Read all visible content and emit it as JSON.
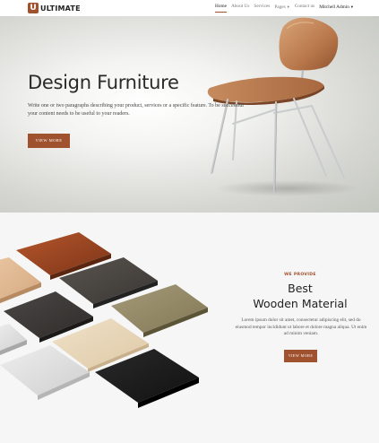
{
  "brand": {
    "logo_letter": "U",
    "name": "ULTIMATE",
    "accent": "#a0512d"
  },
  "nav": {
    "items": [
      {
        "label": "Home",
        "active": true
      },
      {
        "label": "About Us"
      },
      {
        "label": "Services"
      },
      {
        "label": "Pages",
        "dropdown": true
      },
      {
        "label": "Contact us"
      }
    ],
    "user": "Mitchell Admin"
  },
  "hero": {
    "title": "Design Furniture",
    "text": "Write one or two paragraphs describing your product, services or a specific feature. To be successful your content needs to be useful to your readers.",
    "button": "VIEW MORE"
  },
  "section2": {
    "eyebrow": "WE PROVIDE",
    "title_line1": "Best",
    "title_line2": "Wooden Material",
    "text": "Lorem ipsum dolor sit amet, consectetur adipiscing elit, sed do eiusmod tempor incididunt ut labore et dolore magna aliqua. Ut enim ad minim veniam.",
    "button": "VIEW MORE"
  }
}
